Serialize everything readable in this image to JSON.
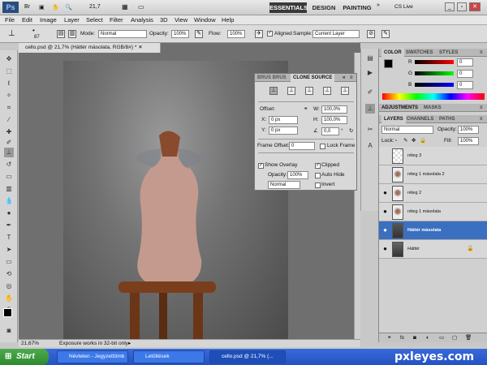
{
  "app": {
    "logo": "Ps",
    "zoom": "21,7",
    "workspaces": [
      "ESSENTIALS",
      "DESIGN",
      "PAINTING"
    ],
    "cslive": "CS Live"
  },
  "menu": [
    "File",
    "Edit",
    "Image",
    "Layer",
    "Select",
    "Filter",
    "Analysis",
    "3D",
    "View",
    "Window",
    "Help"
  ],
  "options": {
    "brush_size": "87",
    "mode_label": "Mode:",
    "mode": "Normal",
    "opacity_label": "Opacity:",
    "opacity": "100%",
    "flow_label": "Flow:",
    "flow": "100%",
    "aligned": "Aligned",
    "sample_label": "Sample:",
    "sample": "Current Layer"
  },
  "document": {
    "tab": "cello.psd @ 21,7% (Háttér másolata, RGB/8#) *",
    "zoom": "21,67%",
    "status": "Exposure works in 32-bit only"
  },
  "clone_panel": {
    "tab1": "BRUS BRUS",
    "tab2": "CLONE SOURCE",
    "offset_label": "Offset:",
    "x_label": "X:",
    "x": "0 px",
    "y_label": "Y:",
    "y": "0 px",
    "w_label": "W:",
    "w": "100,0%",
    "h_label": "H:",
    "h": "100,0%",
    "angle": "0,0",
    "angle_unit": "°",
    "frame_offset_label": "Frame Offset:",
    "frame_offset": "0",
    "lock_frame": "Lock Frame",
    "show_overlay": "Show Overlay",
    "clipped": "Clipped",
    "opacity_label": "Opacity:",
    "opacity": "100%",
    "auto_hide": "Auto Hide",
    "mode": "Normal",
    "invert": "Invert"
  },
  "color_panel": {
    "tabs": [
      "COLOR",
      "SWATCHES",
      "STYLES"
    ],
    "r": "R",
    "g": "G",
    "b": "B",
    "r_val": "0",
    "g_val": "0",
    "b_val": "0"
  },
  "adjust_tabs": [
    "ADJUSTMENTS",
    "MASKS"
  ],
  "layers_panel": {
    "tabs": [
      "LAYERS",
      "CHANNELS",
      "PATHS"
    ],
    "mode": "Normal",
    "opacity_label": "Opacity:",
    "opacity": "100%",
    "lock_label": "Lock:",
    "fill_label": "Fill:",
    "fill": "100%",
    "layers": [
      {
        "name": "réteg 3"
      },
      {
        "name": "réteg 1 másolata 2"
      },
      {
        "name": "réteg 2"
      },
      {
        "name": "réteg 1 másolata"
      },
      {
        "name": "Háttér másolata"
      },
      {
        "name": "Háttér"
      }
    ]
  },
  "taskbar": {
    "start": "Start",
    "items": [
      "Névtelen - Jegyzettömb",
      "Letöltések",
      "cello.psd @ 21,7% (..."
    ],
    "watermark": "pxleyes.com"
  },
  "colors": {
    "selected_layer": "#3b6fc0",
    "taskbar": "#2352c3"
  }
}
